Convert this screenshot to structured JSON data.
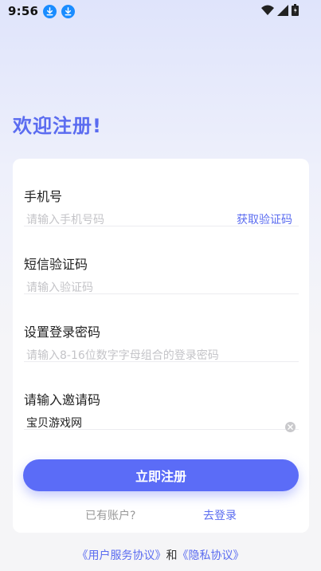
{
  "status_bar": {
    "time": "9:56",
    "icons": [
      "download-icon",
      "download-icon",
      "wifi-icon",
      "signal-icon",
      "battery-icon"
    ]
  },
  "welcome_title": "欢迎注册!",
  "form": {
    "phone": {
      "label": "手机号",
      "placeholder": "请输入手机号码",
      "action": "获取验证码"
    },
    "sms_code": {
      "label": "短信验证码",
      "placeholder": "请输入验证码"
    },
    "password": {
      "label": "设置登录密码",
      "placeholder": "请输入8-16位数字字母组合的登录密码"
    },
    "invite": {
      "label": "请输入邀请码",
      "value": "宝贝游戏网"
    }
  },
  "register_button": "立即注册",
  "login_prompt": {
    "question": "已有账户?",
    "link": "去登录"
  },
  "agreement": {
    "user_agreement": "《用户服务协议》",
    "and": "和",
    "privacy": "《隐私协议》"
  },
  "colors": {
    "accent": "#5b6cf0",
    "download_badge": "#1a8cff"
  }
}
